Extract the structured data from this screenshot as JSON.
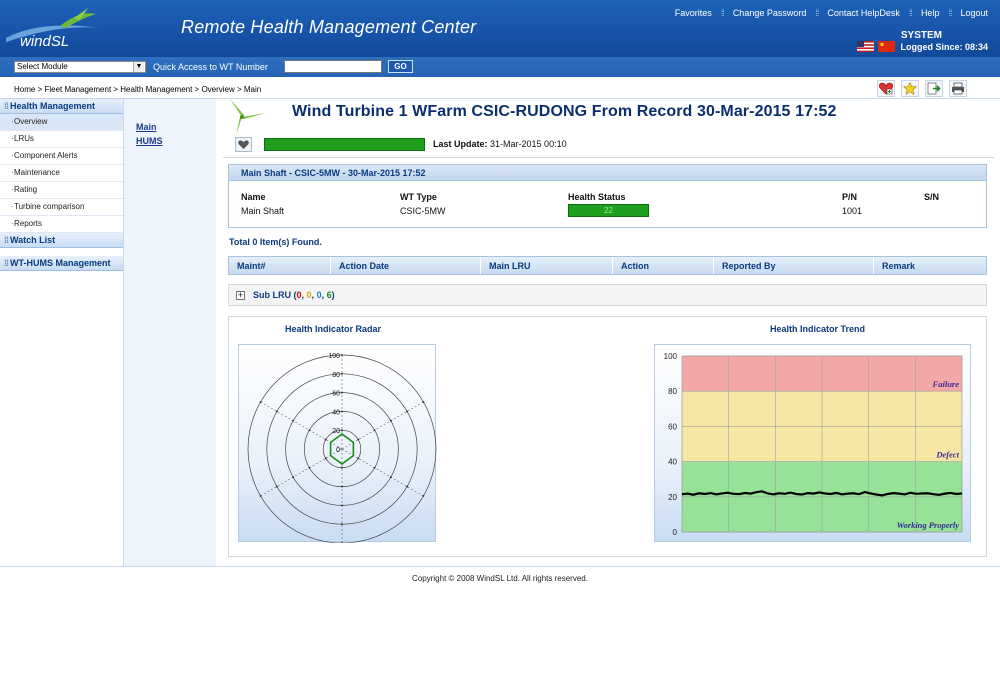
{
  "header": {
    "logo_text": "windSL",
    "app_title": "Remote Health Management Center",
    "links": [
      "Favorites",
      "Change Password",
      "Contact HelpDesk",
      "Help",
      "Logout"
    ],
    "user": "SYSTEM",
    "logged_since": "Logged Since: 08:34",
    "flags": [
      "us-flag-icon",
      "cn-flag-icon"
    ]
  },
  "toolbar": {
    "module_select_value": "Select Module",
    "quick_access_label": "Quick Access to WT Number",
    "quick_access_value": "",
    "go_label": "GO"
  },
  "breadcrumb": "Home > Fleet Management > Health Management > Overview > Main",
  "action_icons": [
    "add-favorite-icon",
    "star-icon",
    "export-icon",
    "print-icon"
  ],
  "sidebar": {
    "sections": [
      {
        "label": "Health Management",
        "items": [
          "Overview",
          "LRUs",
          "Component Alerts",
          "Maintenance",
          "Rating",
          "Turbine comparison",
          "Reports"
        ]
      },
      {
        "label": "Watch List",
        "items": []
      },
      {
        "label": "WT-HUMS Management",
        "items": []
      }
    ],
    "active_item": "Overview"
  },
  "subnav": {
    "links": [
      "Main",
      "HUMS"
    ]
  },
  "main": {
    "title": "Wind Turbine 1  WFarm CSIC-RUDONG  From Record  30-Mar-2015 17:52",
    "last_update_label": "Last Update:",
    "last_update_value": "31-Mar-2015 00:10",
    "overall_health_color": "#1ea01e"
  },
  "shaft": {
    "title": "Main Shaft - CSIC-5MW - 30-Mar-2015 17:52",
    "headers": [
      "Name",
      "WT Type",
      "Health Status",
      "P/N",
      "S/N"
    ],
    "values": {
      "name": "Main Shaft",
      "wt_type": "CSIC-5MW",
      "health_status": "22",
      "pn": "1001",
      "sn": ""
    }
  },
  "total_found": "Total 0 Item(s) Found.",
  "maint_table": {
    "columns": [
      "Maint#",
      "Action Date",
      "Main LRU",
      "Action",
      "Reported By",
      "Remark"
    ],
    "rows": []
  },
  "sub_lru": {
    "label": "Sub LRU",
    "counts": [
      "0",
      "0",
      "0",
      "6"
    ],
    "count_colors": [
      "#cc0000",
      "#d9a400",
      "#1a7dd0",
      "#1a8a1a"
    ],
    "toggle": "+"
  },
  "radar_title": "Health Indicator Radar",
  "trend_title": "Health Indicator Trend",
  "footer": "Copyright © 2008 WindSL Ltd. All rights reserved.",
  "chart_data": [
    {
      "type": "radar",
      "title": "Health Indicator Radar",
      "ylim": [
        0,
        100
      ],
      "ticks": [
        "100",
        "80",
        "60",
        "40",
        "20",
        "0"
      ],
      "axes": 6,
      "values": [
        16,
        14,
        14,
        16,
        14,
        14
      ],
      "series_color": "#1a8a1a"
    },
    {
      "type": "line",
      "title": "Health Indicator Trend",
      "ylim": [
        0,
        100
      ],
      "yticks": [
        "100",
        "80",
        "60",
        "40",
        "20",
        "0"
      ],
      "zones": [
        {
          "label": "Failure",
          "from": 80,
          "to": 100,
          "color": "#f4a7a7"
        },
        {
          "label": "Defect",
          "from": 40,
          "to": 80,
          "color": "#f6e6a3"
        },
        {
          "label": "Working Properly",
          "from": 0,
          "to": 40,
          "color": "#96e296"
        }
      ],
      "values": [
        21.5,
        21.8,
        21.2,
        22.0,
        21.6,
        22.1,
        21.4,
        21.9,
        22.3,
        21.7,
        21.5,
        22.2,
        21.8,
        22.6,
        23.1,
        21.9,
        21.4,
        22.0,
        21.7,
        22.4,
        21.6,
        21.3,
        22.1,
        21.8,
        22.5,
        21.9,
        21.6,
        22.2,
        21.4,
        21.8,
        22.0,
        21.5,
        22.7,
        21.9,
        21.3,
        20.8,
        21.6,
        22.1,
        21.8,
        21.4,
        22.3,
        21.7,
        21.9,
        22.0,
        21.5,
        21.1,
        21.8,
        22.2,
        21.6,
        21.9
      ]
    }
  ]
}
